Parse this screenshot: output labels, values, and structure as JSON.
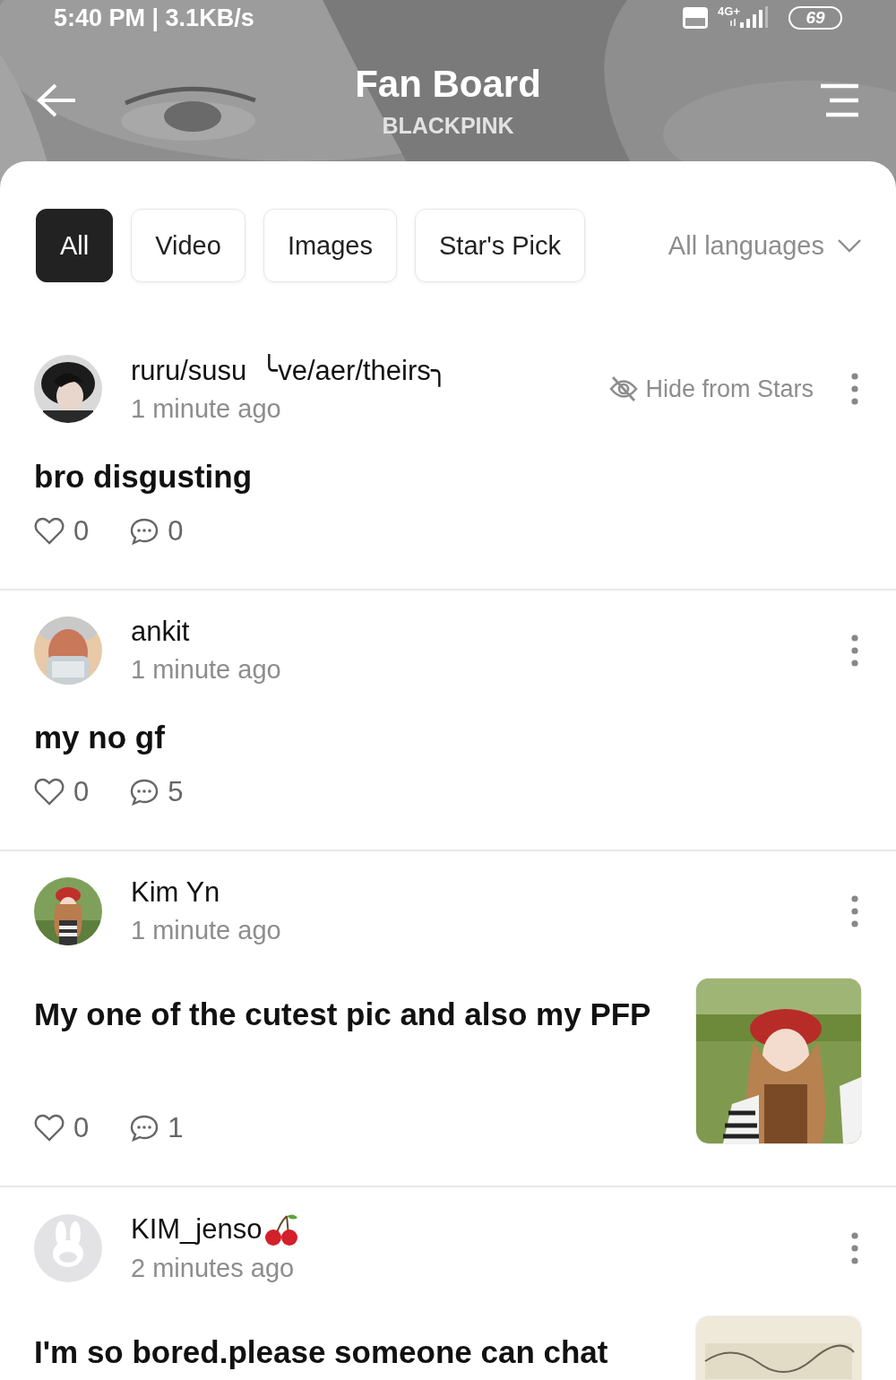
{
  "status_bar": {
    "time": "5:40 PM | 3.1KB/s",
    "network": "4G+",
    "battery": "69"
  },
  "header": {
    "title": "Fan Board",
    "subtitle": "BLACKPINK"
  },
  "tabs": [
    {
      "label": "All",
      "selected": true
    },
    {
      "label": "Video",
      "selected": false
    },
    {
      "label": "Images",
      "selected": false
    },
    {
      "label": "Star's Pick",
      "selected": false
    }
  ],
  "language_filter": "All languages",
  "posts": [
    {
      "author": "ruru/susu",
      "pronouns": "╰ve/aer/theirs╮",
      "time": "1 minute ago",
      "hide_from_stars": "Hide from Stars",
      "text": "bro disgusting",
      "likes": "0",
      "comments": "0"
    },
    {
      "author": "ankit",
      "time": "1 minute ago",
      "text": "my no gf",
      "likes": "0",
      "comments": "5"
    },
    {
      "author": "Kim Yn",
      "time": "1 minute ago",
      "text": "My one of the cutest pic and also my PFP",
      "likes": "0",
      "comments": "1"
    },
    {
      "author": "KIM_jenso",
      "name_icon": true,
      "time": "2 minutes ago",
      "text": "I'm so bored.please someone can chat"
    }
  ]
}
